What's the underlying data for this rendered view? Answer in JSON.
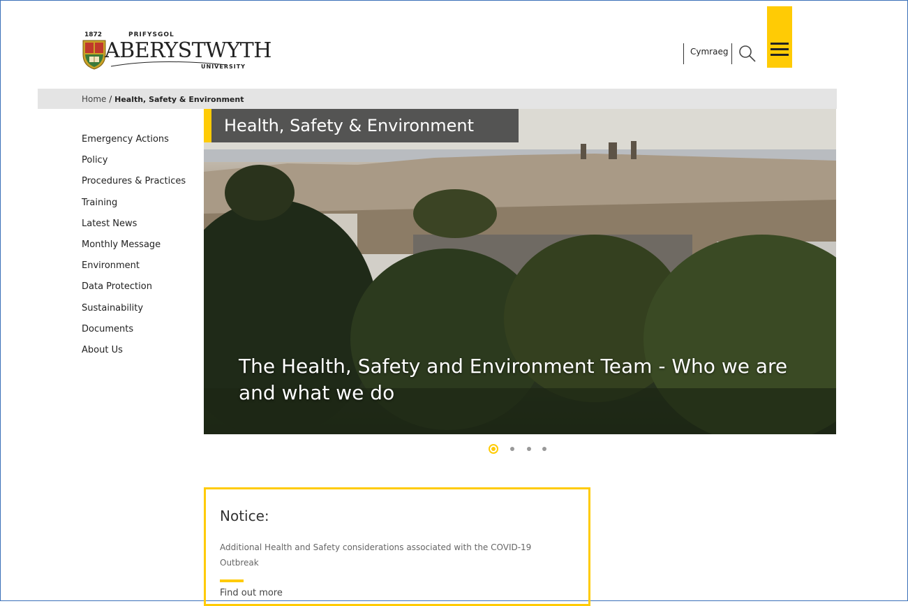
{
  "logo": {
    "year": "1872",
    "welsh_name": "PRIFYSGOL",
    "name": "ABERYSTWYTH",
    "subtitle": "UNIVERSITY"
  },
  "header": {
    "language_link": "Cymraeg",
    "search_icon": "search-icon",
    "menu_icon": "hamburger-menu-icon",
    "accent_color": "#ffcb05"
  },
  "breadcrumb": {
    "home": "Home",
    "separator": " / ",
    "current": "Health, Safety & Environment"
  },
  "sidebar": {
    "items": [
      {
        "label": "Emergency Actions"
      },
      {
        "label": "Policy"
      },
      {
        "label": "Procedures & Practices"
      },
      {
        "label": "Training"
      },
      {
        "label": "Latest News"
      },
      {
        "label": "Monthly Message"
      },
      {
        "label": "Environment"
      },
      {
        "label": "Data Protection"
      },
      {
        "label": "Sustainability"
      },
      {
        "label": "Documents"
      },
      {
        "label": "About Us"
      }
    ]
  },
  "hero": {
    "title": "Health, Safety & Environment",
    "caption": "The Health, Safety and Environment Team - Who we are and what we do",
    "slides_total": 4,
    "active_slide": 1
  },
  "notice": {
    "heading": "Notice:",
    "body": "Additional Health and Safety considerations associated with the COVID-19 Outbreak",
    "link": "Find out more"
  }
}
